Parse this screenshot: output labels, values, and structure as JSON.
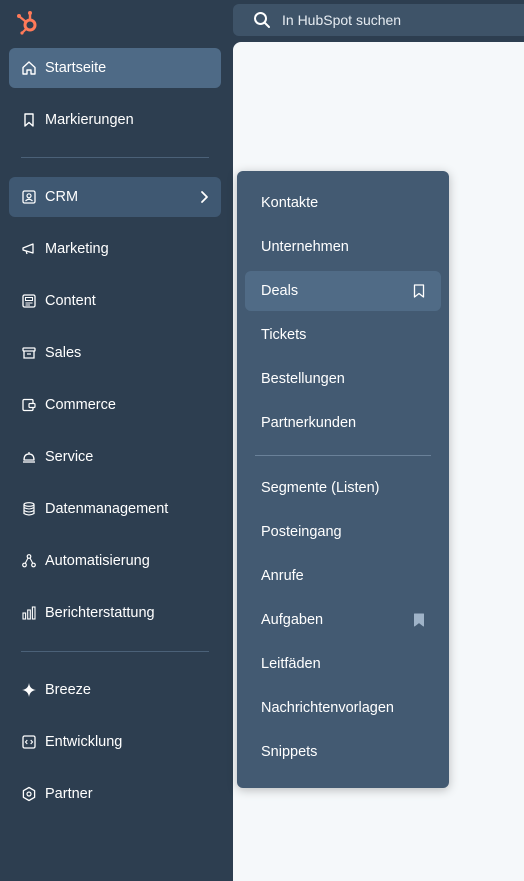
{
  "search": {
    "placeholder": "In HubSpot suchen"
  },
  "sidebar": {
    "items": [
      {
        "label": "Startseite",
        "icon": "home-icon"
      },
      {
        "label": "Markierungen",
        "icon": "bookmark-icon"
      },
      {
        "label": "CRM",
        "icon": "contacts-icon"
      },
      {
        "label": "Marketing",
        "icon": "megaphone-icon"
      },
      {
        "label": "Content",
        "icon": "content-icon"
      },
      {
        "label": "Sales",
        "icon": "sales-icon"
      },
      {
        "label": "Commerce",
        "icon": "commerce-icon"
      },
      {
        "label": "Service",
        "icon": "service-bell-icon"
      },
      {
        "label": "Datenmanagement",
        "icon": "database-icon"
      },
      {
        "label": "Automatisierung",
        "icon": "automation-icon"
      },
      {
        "label": "Berichterstattung",
        "icon": "bar-chart-icon"
      },
      {
        "label": "Breeze",
        "icon": "sparkle-icon"
      },
      {
        "label": "Entwicklung",
        "icon": "code-icon"
      },
      {
        "label": "Partner",
        "icon": "partner-icon"
      }
    ]
  },
  "crm_menu": {
    "items": [
      {
        "label": "Kontakte"
      },
      {
        "label": "Unternehmen"
      },
      {
        "label": "Deals"
      },
      {
        "label": "Tickets"
      },
      {
        "label": "Bestellungen"
      },
      {
        "label": "Partnerkunden"
      },
      {
        "label": "Segmente (Listen)"
      },
      {
        "label": "Posteingang"
      },
      {
        "label": "Anrufe"
      },
      {
        "label": "Aufgaben"
      },
      {
        "label": "Leitfäden"
      },
      {
        "label": "Nachrichtenvorlagen"
      },
      {
        "label": "Snippets"
      }
    ]
  },
  "colors": {
    "sidebar_bg": "#2d3e50",
    "flyout_bg": "#435a72",
    "logo": "#ff7a59"
  }
}
